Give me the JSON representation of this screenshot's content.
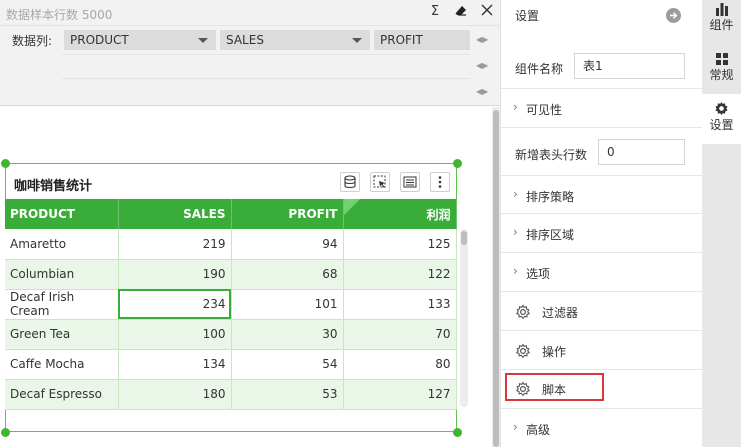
{
  "data_panel": {
    "title": "数据样本行数 5000",
    "label": "数据列:",
    "fields": [
      "PRODUCT",
      "SALES",
      "PROFIT"
    ],
    "icons": [
      "sigma-icon",
      "eraser-icon",
      "close-icon"
    ]
  },
  "component": {
    "title": "咖啡销售统计",
    "buttons": [
      "database-icon",
      "select-icon",
      "list-settings-icon",
      "more-icon"
    ],
    "columns": [
      "PRODUCT",
      "SALES",
      "PROFIT",
      "利润"
    ],
    "rows": [
      [
        "Amaretto",
        "219",
        "94",
        "125"
      ],
      [
        "Columbian",
        "190",
        "68",
        "122"
      ],
      [
        "Decaf Irish Cream",
        "234",
        "101",
        "133"
      ],
      [
        "Green Tea",
        "100",
        "30",
        "70"
      ],
      [
        "Caffe Mocha",
        "134",
        "54",
        "80"
      ],
      [
        "Decaf Espresso",
        "180",
        "53",
        "127"
      ]
    ],
    "accent": "#3aac3a"
  },
  "settings": {
    "title": "设置",
    "name_label": "组件名称",
    "name_value": "表1",
    "visibility": "可见性",
    "header_rows_label": "新增表头行数",
    "header_rows_value": "0",
    "sort_strategy": "排序策略",
    "sort_area": "排序区域",
    "options": "选项",
    "filter": "过滤器",
    "operation": "操作",
    "script": "脚本",
    "advanced": "高级"
  },
  "tabs": {
    "components": "组件",
    "general": "常规",
    "settings": "设置"
  }
}
